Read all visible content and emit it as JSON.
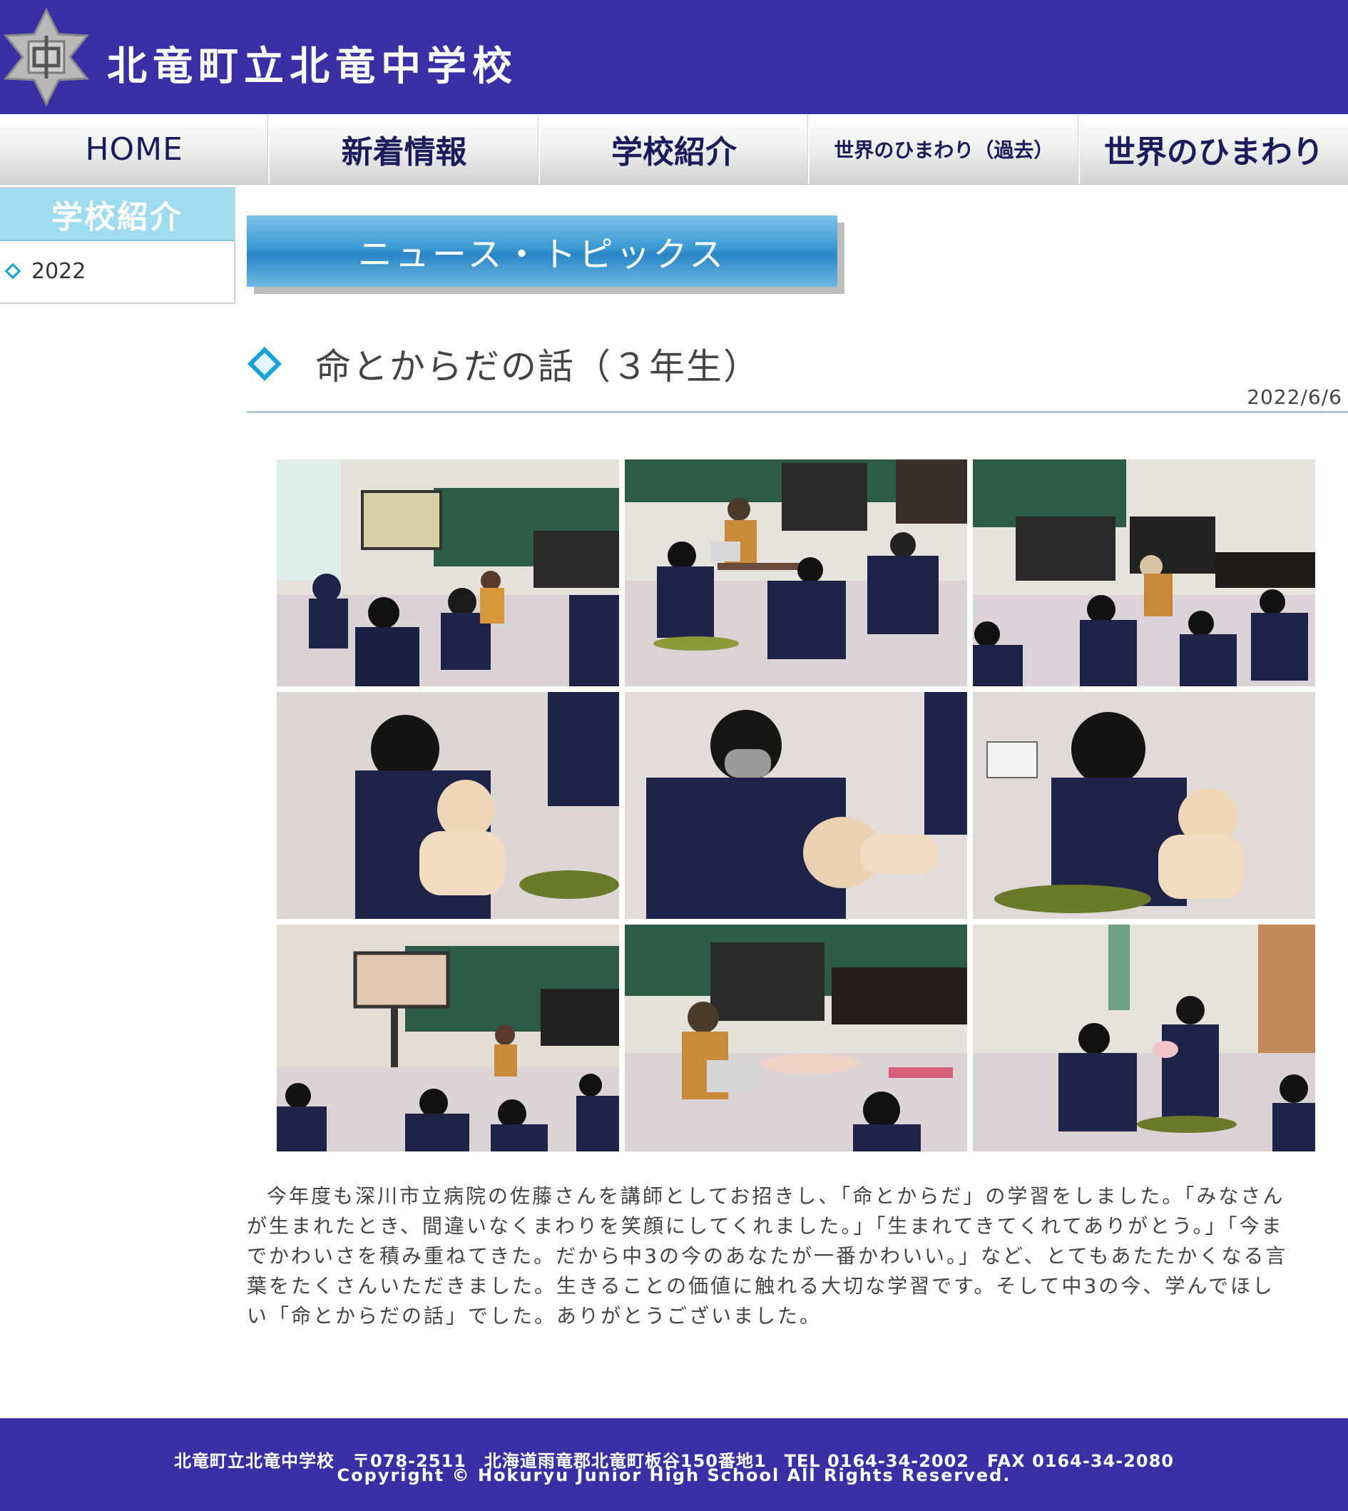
{
  "header": {
    "school_name": "北竜町立北竜中学校",
    "logo_char": "中"
  },
  "nav": {
    "items": [
      {
        "label": "HOME"
      },
      {
        "label": "新着情報"
      },
      {
        "label": "学校紹介"
      },
      {
        "label": "世界のひまわり（過去）"
      },
      {
        "label": "世界のひまわり"
      }
    ]
  },
  "sidebar": {
    "heading": "学校紹介",
    "items": [
      {
        "label": "2022"
      }
    ]
  },
  "main": {
    "banner": "ニュース・トピックス",
    "article": {
      "title": "命とからだの話（３年生）",
      "date": "2022/6/6",
      "body": "今年度も深川市立病院の佐藤さんを講師としてお招きし、「命とからだ」の学習をしました。「みなさんが生まれたとき、間違いなくまわりを笑顔にしてくれました。」「生まれてきてくれてありがとう。」「今までかわいさを積み重ねてきた。だから中3の今のあなたが一番かわいい。」など、とてもあたたかくなる言葉をたくさんいただきました。生きることの価値に触れる大切な学習です。そして中3の今、学んでほしい「命とからだの話」でした。ありがとうございました。"
    }
  },
  "footer": {
    "line1": "北竜町立北竜中学校　〒078-2511　北海道雨竜郡北竜町板谷150番地1　TEL 0164-34-2002　FAX 0164-34-2080",
    "copyright": "Copyright © Hokuryu Junior High School All Rights Reserved."
  },
  "colors": {
    "header_bg": "#3a2fa5",
    "nav_text": "#1c1c5c",
    "accent_blue": "#1aa0d8",
    "sidebar_head": "#9fdcef"
  }
}
